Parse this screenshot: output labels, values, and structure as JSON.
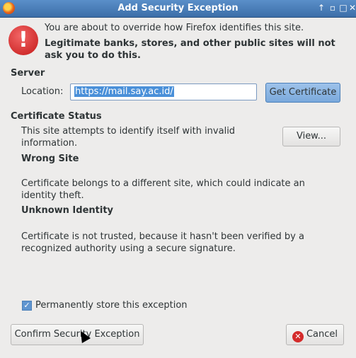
{
  "window": {
    "title": "Add Security Exception",
    "controls": {
      "pin": "↑",
      "minimize": "▫",
      "maximize": "□",
      "close": "✕"
    }
  },
  "warning": {
    "icon": "!",
    "line1": "You are about to override how Firefox identifies this site.",
    "line2": "Legitimate banks, stores, and other public sites will not ask you to do this."
  },
  "server": {
    "heading": "Server",
    "location_label": "Location:",
    "location_value": "https://mail.say.ac.id/",
    "get_certificate_label": "Get Certificate"
  },
  "certificate_status": {
    "heading": "Certificate Status",
    "summary": "This site attempts to identify itself with invalid information.",
    "view_label": "View...",
    "issues": [
      {
        "title": "Wrong Site",
        "description": "Certificate belongs to a different site, which could indicate an identity theft."
      },
      {
        "title": "Unknown Identity",
        "description": "Certificate is not trusted, because it hasn't been verified by a recognized authority using a secure signature."
      }
    ]
  },
  "permanent": {
    "label": "Permanently store this exception",
    "checked": true
  },
  "actions": {
    "confirm_label": "Confirm Security Exception",
    "cancel_label": "Cancel"
  },
  "colors": {
    "titlebar": "#3c6ea8",
    "accent": "#7aa9dc",
    "warning": "#c41818"
  }
}
